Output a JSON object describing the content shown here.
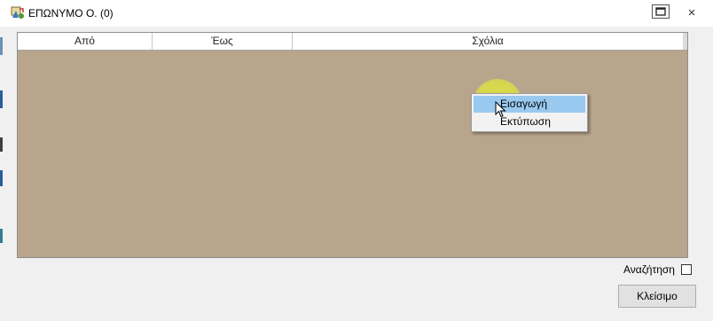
{
  "window": {
    "title": "ΕΠΩΝΥΜΟ Ο. (0)",
    "close_glyph": "×"
  },
  "grid": {
    "columns": [
      "Από",
      "Έως",
      "Σχόλια"
    ],
    "background_color": "#b8a58c",
    "rows": []
  },
  "context_menu": {
    "items": [
      {
        "label": "Εισαγωγή",
        "highlighted": true
      },
      {
        "label": "Εκτύπωση",
        "highlighted": false
      }
    ]
  },
  "footer": {
    "search_label": "Αναζήτηση",
    "search_checked": false,
    "close_button_label": "Κλείσιμο"
  }
}
